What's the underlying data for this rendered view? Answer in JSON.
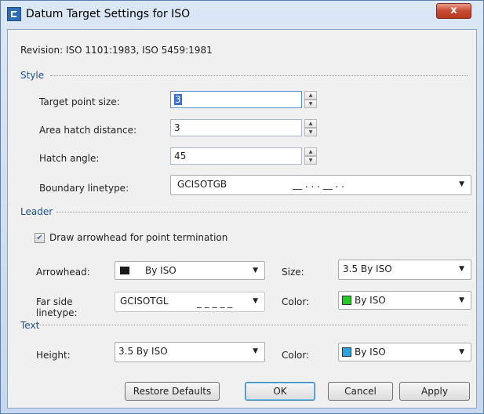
{
  "window": {
    "title": "Datum Target Settings for ISO",
    "close_glyph": "x"
  },
  "revision": "Revision: ISO 1101:1983, ISO 5459:1981",
  "style": {
    "group_title": "Style",
    "target_point_size": {
      "label": "Target point size:",
      "value": "3"
    },
    "area_hatch_distance": {
      "label": "Area hatch distance:",
      "value": "3"
    },
    "hatch_angle": {
      "label": "Hatch angle:",
      "value": "45"
    },
    "boundary_linetype": {
      "label": "Boundary linetype:",
      "value": "GCISOTGB",
      "preview": "__ . . . __ . ."
    }
  },
  "leader": {
    "group_title": "Leader",
    "draw_arrowhead": {
      "label": "Draw arrowhead for point termination",
      "checked": true
    },
    "arrowhead": {
      "label": "Arrowhead:",
      "value": "By ISO"
    },
    "size": {
      "label": "Size:",
      "value": "3.5 By ISO"
    },
    "far_side_linetype": {
      "label_line1": "Far side",
      "label_line2": "linetype:",
      "value": "GCISOTGL",
      "preview": "_ _ _ _ _"
    },
    "color": {
      "label": "Color:",
      "value": "By ISO",
      "swatch": "#22cc22"
    }
  },
  "text": {
    "group_title": "Text",
    "height": {
      "label": "Height:",
      "value": "3.5 By ISO"
    },
    "color": {
      "label": "Color:",
      "value": "By ISO",
      "swatch": "#2aa4e0"
    }
  },
  "buttons": {
    "restore_defaults": "Restore Defaults",
    "ok": "OK",
    "cancel": "Cancel",
    "apply": "Apply"
  },
  "colors": {
    "accent": "#1d4f8c",
    "titlebar": "#c6d8ee",
    "close": "#c74a32"
  }
}
